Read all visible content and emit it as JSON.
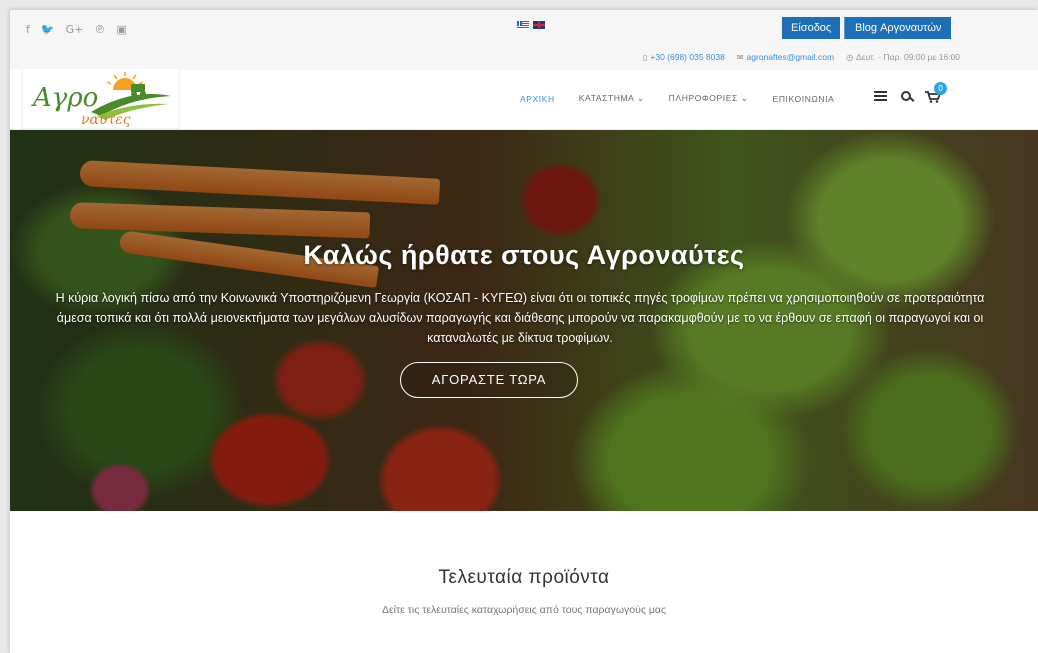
{
  "topbar": {
    "social": [
      {
        "icon": "facebook-icon",
        "glyph": "f"
      },
      {
        "icon": "twitter-icon",
        "glyph": "🐦"
      },
      {
        "icon": "google-plus-icon",
        "glyph": "G+"
      },
      {
        "icon": "pinterest-icon",
        "glyph": "℗"
      },
      {
        "icon": "youtube-icon",
        "glyph": "▣"
      }
    ],
    "login_label": "Είσοδος",
    "blog_label": "Blog Αργοναυτών",
    "phone": "+30 (698) 035 8038",
    "email": "agronaftes@gmail.com",
    "hours": "Δευτ. - Παρ. 09:00 με 16:00"
  },
  "header": {
    "logo_text_top": "Αγρο",
    "logo_text_bottom": "ναύτες",
    "nav": [
      {
        "label": "ΑΡΧΙΚΗ",
        "active": true
      },
      {
        "label": "ΚΑΤΑΣΤΗΜΑ ⌄",
        "active": false
      },
      {
        "label": "ΠΛΗΡΟΦΟΡΙΕΣ ⌄",
        "active": false
      },
      {
        "label": "ΕΠΙΚΟΙΝΩΝΙΑ",
        "active": false
      }
    ],
    "cart_count": "0"
  },
  "hero": {
    "title": "Καλώς ήρθατε στους Αγροναύτες",
    "text": "Η κύρια λογική πίσω από την Κοινωνικά Υποστηριζόμενη Γεωργία (ΚΟΣΑΠ - ΚΥΓΕΩ) είναι ότι οι τοπικές πηγές τροφίμων πρέπει να χρησιμοποιηθούν σε προτεραιότητα άμεσα τοπικά και ότι πολλά μειονεκτήματα των μεγάλων αλυσίδων παραγωγής και διάθεσης μπορούν να παρακαμφθούν με το να έρθουν σε επαφή οι παραγωγοί και οι καταναλωτές με δίκτυα τροφίμων.",
    "button_label": "ΑΓΟΡΑΣΤΕ ΤΩΡΑ"
  },
  "products": {
    "title": "Τελευταία προϊόντα",
    "subtitle": "Δείτε τις τελευταίες καταχωρήσεις από τους παραγωγούς μας"
  },
  "colors": {
    "accent": "#1d6fb8",
    "link": "#3a8fd6",
    "logo_green": "#4a8a2a",
    "logo_orange": "#e07a1e"
  }
}
